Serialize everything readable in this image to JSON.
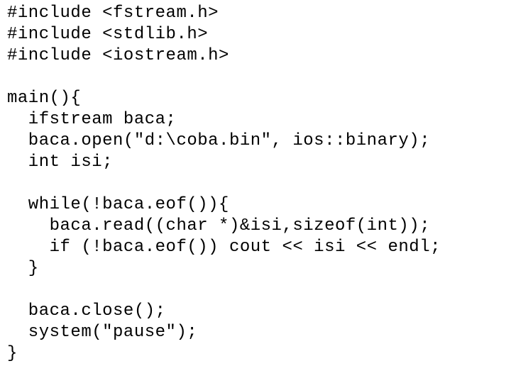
{
  "code": {
    "lines": [
      "#include <fstream.h>",
      "#include <stdlib.h>",
      "#include <iostream.h>",
      "",
      "main(){",
      "  ifstream baca;",
      "  baca.open(\"d:\\coba.bin\", ios::binary);",
      "  int isi;",
      "",
      "  while(!baca.eof()){",
      "    baca.read((char *)&isi,sizeof(int));",
      "    if (!baca.eof()) cout << isi << endl;",
      "  }",
      "",
      "  baca.close();",
      "  system(\"pause\");",
      "}"
    ]
  }
}
